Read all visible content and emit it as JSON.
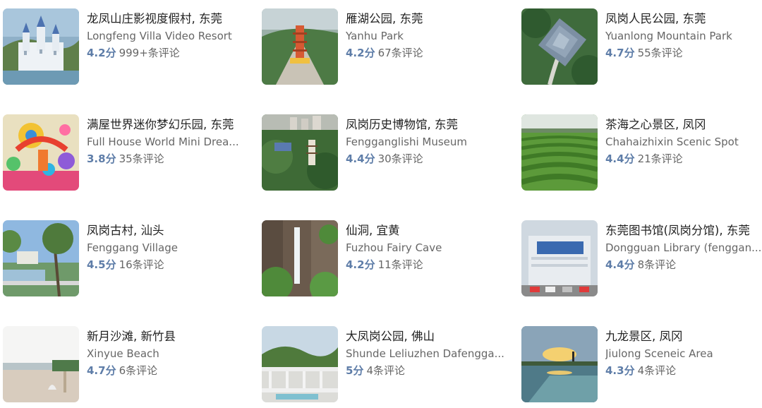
{
  "places": [
    {
      "title": "龙凤山庄影视度假村, 东莞",
      "subtitle": "Longfeng Villa Video Resort",
      "rating": "4.2分",
      "reviews": "999+条评论",
      "image": "castle-image"
    },
    {
      "title": "雁湖公园, 东莞",
      "subtitle": "Yanhu Park",
      "rating": "4.2分",
      "reviews": "67条评论",
      "image": "pagoda-park-image"
    },
    {
      "title": "凤岗人民公园, 东莞",
      "subtitle": "Yuanlong Mountain Park",
      "rating": "4.7分",
      "reviews": "55条评论",
      "image": "pavilion-aerial-image"
    },
    {
      "title": "满屋世界迷你梦幻乐园, 东莞",
      "subtitle": "Full House World Mini Drea...",
      "rating": "3.8分",
      "reviews": "35条评论",
      "image": "colorful-amusement-image"
    },
    {
      "title": "凤岗历史博物馆, 东莞",
      "subtitle": "Fengganglishi Museum",
      "rating": "4.4分",
      "reviews": "30条评论",
      "image": "hill-pagoda-image"
    },
    {
      "title": "茶海之心景区, 凤冈",
      "subtitle": "Chahaizhixin Scenic Spot",
      "rating": "4.4分",
      "reviews": "21条评论",
      "image": "tea-field-image"
    },
    {
      "title": "凤岗古村, 汕头",
      "subtitle": "Fenggang Village",
      "rating": "4.5分",
      "reviews": "16条评论",
      "image": "riverside-village-image"
    },
    {
      "title": "仙洞, 宜黄",
      "subtitle": "Fuzhou Fairy Cave",
      "rating": "4.2分",
      "reviews": "11条评论",
      "image": "waterfall-image"
    },
    {
      "title": "东莞图书馆(凤岗分馆), 东莞",
      "subtitle": "Dongguan Library (fenggan...",
      "rating": "4.4分",
      "reviews": "8条评论",
      "image": "library-building-image"
    },
    {
      "title": "新月沙滩, 新竹县",
      "subtitle": "Xinyue Beach",
      "rating": "4.7分",
      "reviews": "6条评论",
      "image": "beach-image"
    },
    {
      "title": "大凤岗公园, 佛山",
      "subtitle": "Shunde Leliuzhen Dafengga...",
      "rating": "5分",
      "reviews": "4条评论",
      "image": "park-railing-image"
    },
    {
      "title": "九龙景区, 凤冈",
      "subtitle": "Jiulong Sceneic Area",
      "rating": "4.3分",
      "reviews": "4条评论",
      "image": "sunset-lake-image"
    }
  ]
}
